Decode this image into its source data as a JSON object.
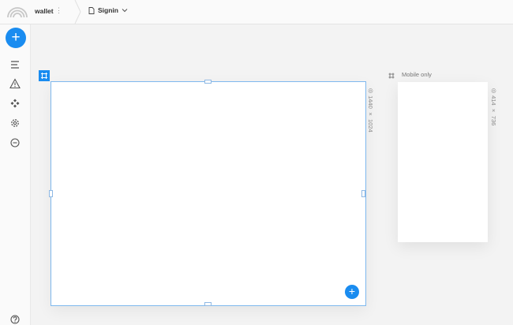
{
  "app": {
    "project_name": "wallet",
    "project_menu": "⋮",
    "page_selector": "Signin"
  },
  "canvas": {
    "desktop_frame": {
      "size_label": "1440 × 1024"
    },
    "mobile_frame": {
      "title": "Mobile only",
      "size_label": "414 × 736"
    },
    "add_label": "+"
  },
  "sidebar": {
    "add_label": "+",
    "items": [
      "layers-icon",
      "warning-icon",
      "components-icon",
      "settings-icon",
      "minus-circle-icon"
    ],
    "help": "help-icon"
  },
  "colors": {
    "accent": "#1a8cf0",
    "frame_border": "#7fb8ee"
  }
}
